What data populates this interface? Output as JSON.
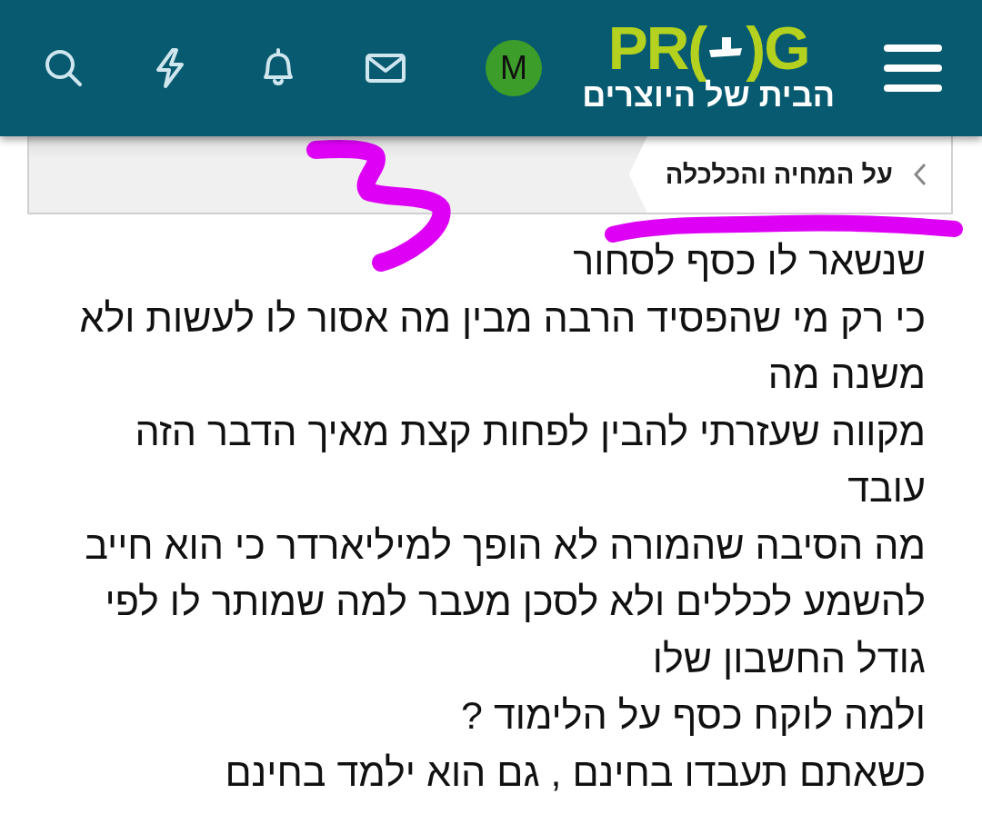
{
  "header": {
    "logo_latin_left": "PR(",
    "logo_latin_right": ")G",
    "logo_tagline": "הבית של היוצרים",
    "avatar_letter": "M"
  },
  "breadcrumb": {
    "label": "על המחיה והכלכלה"
  },
  "post_lines": [
    "שנשאר לו כסף לסחור",
    "כי רק מי שהפסיד הרבה מבין מה אסור לו לעשות ולא",
    "משנה מה",
    "מקווה שעזרתי להבין לפחות קצת מאיך הדבר הזה",
    "עובד",
    "מה הסיבה שהמורה לא הופך למיליארדר כי הוא חייב",
    "להשמע לכללים ולא לסכן מעבר למה שמותר לו לפי",
    "גודל החשבון שלו",
    "ולמה לוקח כסף על הלימוד ?",
    "כשאתם תעבדו בחינם , גם הוא ילמד בחינם"
  ]
}
